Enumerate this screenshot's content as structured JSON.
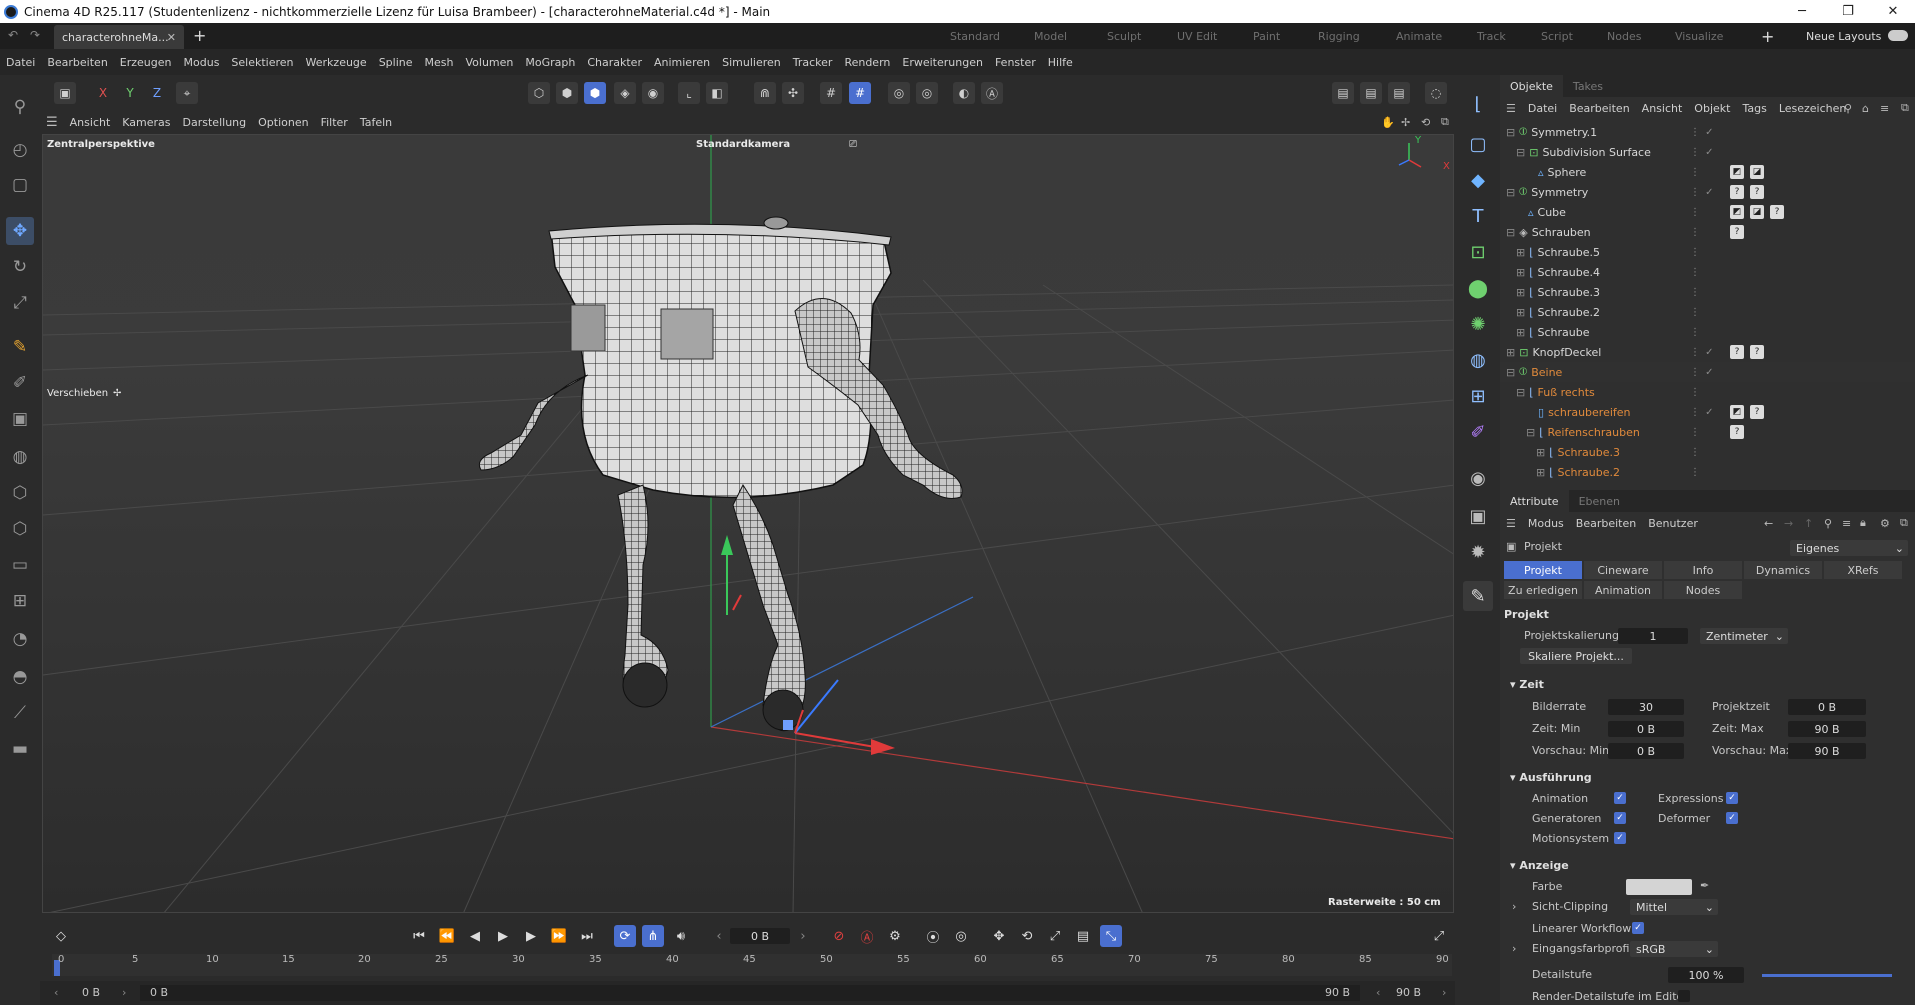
{
  "window": {
    "title": "Cinema 4D R25.117 (Studentenlizenz - nichtkommerzielle Lizenz für Luisa Brambeer) - [characterohneMaterial.c4d *] - Main",
    "minimize": "─",
    "maximize": "❐",
    "close": "✕"
  },
  "doc_tab": {
    "label": "characterohneMa...",
    "close": "✕",
    "add": "+"
  },
  "layouts": [
    "Standard",
    "Model",
    "Sculpt",
    "UV Edit",
    "Paint",
    "Rigging",
    "Animate",
    "Track",
    "Script",
    "Nodes",
    "Visualize"
  ],
  "layouts_add": "+",
  "neue_layouts": "Neue Layouts",
  "menu": [
    "Datei",
    "Bearbeiten",
    "Erzeugen",
    "Modus",
    "Selektieren",
    "Werkzeuge",
    "Spline",
    "Mesh",
    "Volumen",
    "MoGraph",
    "Charakter",
    "Animieren",
    "Simulieren",
    "Tracker",
    "Rendern",
    "Erweiterungen",
    "Fenster",
    "Hilfe"
  ],
  "toolbar": {
    "x": "X",
    "y": "Y",
    "z": "Z"
  },
  "viewport_menu": [
    "Ansicht",
    "Kameras",
    "Darstellung",
    "Optionen",
    "Filter",
    "Tafeln"
  ],
  "viewport": {
    "perspective": "Zentralperspektive",
    "camera": "Standardkamera",
    "tool": "Verschieben",
    "grid": "Rasterweite : 50 cm",
    "axis_y": "Y",
    "axis_x": "X"
  },
  "objects_panel": {
    "tabs": [
      "Objekte",
      "Takes"
    ],
    "menu": [
      "Datei",
      "Bearbeiten",
      "Ansicht",
      "Objekt",
      "Tags",
      "Lesezeichen"
    ],
    "rows": [
      {
        "name": "Symmetry.1"
      },
      {
        "name": "Subdivision Surface"
      },
      {
        "name": "Sphere"
      },
      {
        "name": "Symmetry"
      },
      {
        "name": "Cube"
      },
      {
        "name": "Schrauben"
      },
      {
        "name": "Schraube.5"
      },
      {
        "name": "Schraube.4"
      },
      {
        "name": "Schraube.3"
      },
      {
        "name": "Schraube.2"
      },
      {
        "name": "Schraube"
      },
      {
        "name": "KnopfDeckel"
      },
      {
        "name": "Beine"
      },
      {
        "name": "Fuß rechts"
      },
      {
        "name": "schraubereifen"
      },
      {
        "name": "Reifenschrauben"
      },
      {
        "name": "Schraube.3"
      },
      {
        "name": "Schraube.2"
      }
    ]
  },
  "attributes": {
    "tabs": [
      "Attribute",
      "Ebenen"
    ],
    "menu": [
      "Modus",
      "Bearbeiten",
      "Benutzer"
    ],
    "object": "Projekt",
    "preset": "Eigenes",
    "subtabs": [
      "Projekt",
      "Cineware",
      "Info",
      "Dynamics",
      "XRefs"
    ],
    "subtabs2": [
      "Zu erledigen",
      "Animation",
      "Nodes"
    ],
    "section_main": "Projekt",
    "projektskalierung_label": "Projektskalierung",
    "projektskalierung_value": "1",
    "unit": "Zentimeter",
    "skalieren_button": "Skaliere Projekt...",
    "zeit": "Zeit",
    "bilderrate_label": "Bilderrate",
    "bilderrate": "30",
    "projektzeit_label": "Projektzeit",
    "projektzeit": "0 B",
    "zeit_min_label": "Zeit: Min",
    "zeit_min": "0 B",
    "zeit_max_label": "Zeit: Max",
    "zeit_max": "90 B",
    "vorschau_min_label": "Vorschau: Min",
    "vorschau_min": "0 B",
    "vorschau_max_label": "Vorschau: Max",
    "vorschau_max": "90 B",
    "ausfuehrung": "Ausführung",
    "animation": "Animation",
    "expressions": "Expressions",
    "generatoren": "Generatoren",
    "deformer": "Deformer",
    "motionsystem": "Motionsystem",
    "anzeige": "Anzeige",
    "farbe": "Farbe",
    "sicht_clipping": "Sicht-Clipping",
    "sicht_value": "Mittel",
    "linear_workflow": "Linearer Workflow",
    "eingangsfarbprofil": "Eingangsfarbprofil",
    "farbprofil_value": "sRGB",
    "detailstufe": "Detailstufe",
    "detail_value": "100 %",
    "render_detail": "Render-Detailstufe im Editor"
  },
  "timeline": {
    "frame": "0 B",
    "ruler": [
      "0",
      "5",
      "10",
      "15",
      "20",
      "25",
      "30",
      "35",
      "40",
      "45",
      "50",
      "55",
      "60",
      "65",
      "70",
      "75",
      "80",
      "85",
      "90"
    ],
    "start": "0 B",
    "start2": "0 B",
    "end": "90 B",
    "end2": "90 B"
  },
  "colors": {
    "accent": "#4a6fcf",
    "orange": "#e08a3c",
    "background": "#2b2b2b"
  }
}
